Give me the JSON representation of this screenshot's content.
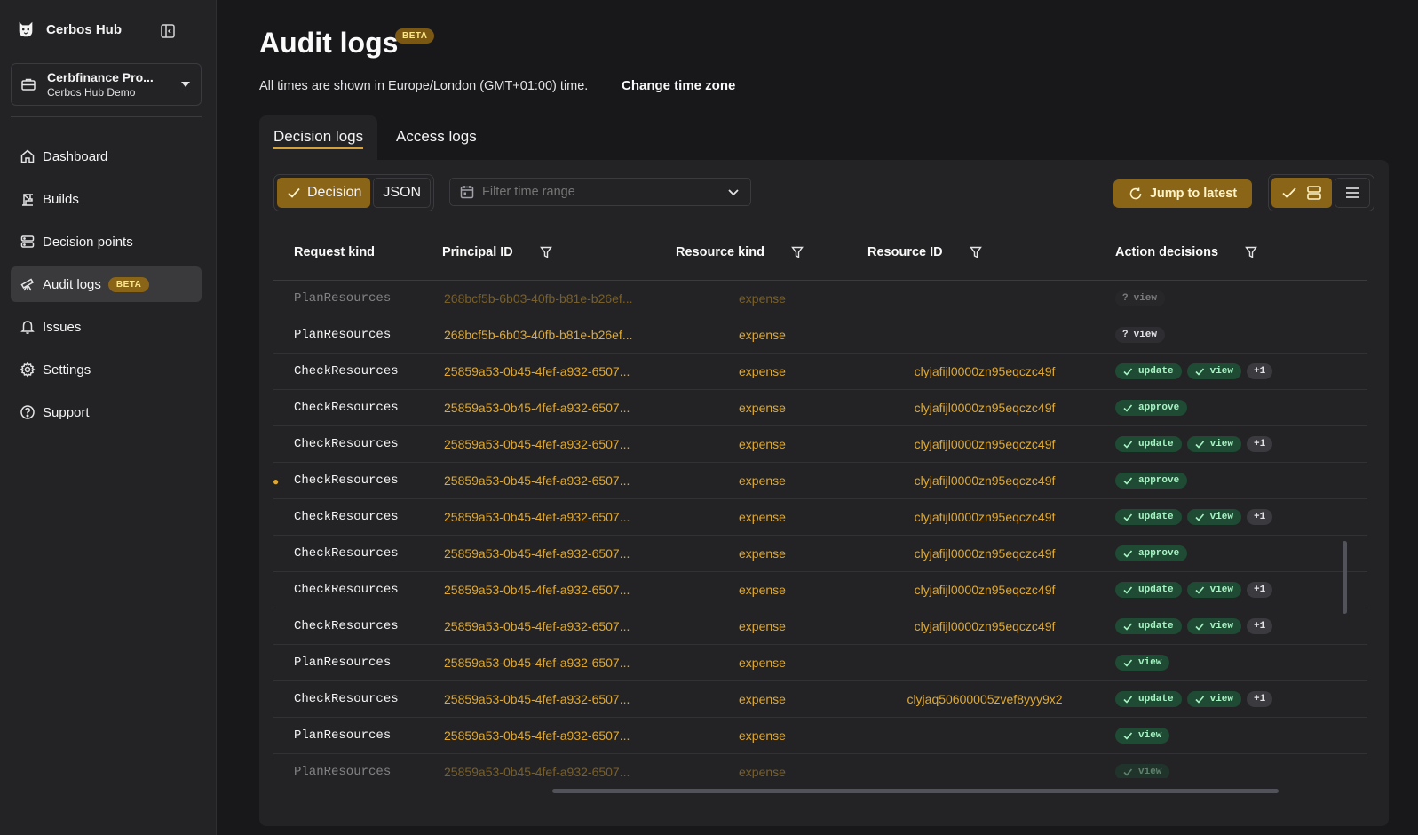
{
  "brand": {
    "name": "Cerbos Hub"
  },
  "org": {
    "name": "Cerbfinance Pro...",
    "subtitle": "Cerbos Hub Demo"
  },
  "nav": {
    "items": [
      {
        "label": "Dashboard",
        "icon": "home-icon"
      },
      {
        "label": "Builds",
        "icon": "crane-icon"
      },
      {
        "label": "Decision points",
        "icon": "server-icon"
      },
      {
        "label": "Audit logs",
        "icon": "telescope-icon",
        "badge": "BETA",
        "active": true
      },
      {
        "label": "Issues",
        "icon": "bell-icon"
      },
      {
        "label": "Settings",
        "icon": "gear-icon"
      },
      {
        "label": "Support",
        "icon": "help-circle-icon"
      }
    ]
  },
  "page": {
    "title": "Audit logs",
    "beta": "BETA",
    "tz_note": "All times are shown in Europe/London (GMT+01:00) time.",
    "tz_link": "Change time zone"
  },
  "tabs": {
    "decision": "Decision logs",
    "access": "Access logs"
  },
  "toolbar": {
    "seg_decision": "Decision",
    "seg_json": "JSON",
    "time_placeholder": "Filter time range",
    "jump": "Jump to latest"
  },
  "table": {
    "headers": {
      "kind": "Request kind",
      "principal": "Principal ID",
      "rkind": "Resource kind",
      "rid": "Resource ID",
      "actions": "Action decisions"
    },
    "rows": [
      {
        "kind": "PlanResources",
        "principal": "268bcf5b-6b03-40fb-b81e-b26ef...",
        "rkind": "expense",
        "rid": "",
        "actions": [
          {
            "label": "view",
            "type": "unknown"
          }
        ],
        "fade": true
      },
      {
        "kind": "PlanResources",
        "principal": "268bcf5b-6b03-40fb-b81e-b26ef...",
        "rkind": "expense",
        "rid": "",
        "actions": [
          {
            "label": "view",
            "type": "unknown"
          }
        ]
      },
      {
        "kind": "CheckResources",
        "principal": "25859a53-0b45-4fef-a932-6507...",
        "rkind": "expense",
        "rid": "clyjafijl0000zn95eqczc49f",
        "actions": [
          {
            "label": "update",
            "type": "allow"
          },
          {
            "label": "view",
            "type": "allow"
          },
          {
            "label": "+1",
            "type": "more"
          }
        ]
      },
      {
        "kind": "CheckResources",
        "principal": "25859a53-0b45-4fef-a932-6507...",
        "rkind": "expense",
        "rid": "clyjafijl0000zn95eqczc49f",
        "actions": [
          {
            "label": "approve",
            "type": "allow"
          }
        ]
      },
      {
        "kind": "CheckResources",
        "principal": "25859a53-0b45-4fef-a932-6507...",
        "rkind": "expense",
        "rid": "clyjafijl0000zn95eqczc49f",
        "actions": [
          {
            "label": "update",
            "type": "allow"
          },
          {
            "label": "view",
            "type": "allow"
          },
          {
            "label": "+1",
            "type": "more"
          }
        ]
      },
      {
        "kind": "CheckResources",
        "principal": "25859a53-0b45-4fef-a932-6507...",
        "rkind": "expense",
        "rid": "clyjafijl0000zn95eqczc49f",
        "actions": [
          {
            "label": "approve",
            "type": "allow"
          }
        ],
        "mark": true
      },
      {
        "kind": "CheckResources",
        "principal": "25859a53-0b45-4fef-a932-6507...",
        "rkind": "expense",
        "rid": "clyjafijl0000zn95eqczc49f",
        "actions": [
          {
            "label": "update",
            "type": "allow"
          },
          {
            "label": "view",
            "type": "allow"
          },
          {
            "label": "+1",
            "type": "more"
          }
        ]
      },
      {
        "kind": "CheckResources",
        "principal": "25859a53-0b45-4fef-a932-6507...",
        "rkind": "expense",
        "rid": "clyjafijl0000zn95eqczc49f",
        "actions": [
          {
            "label": "approve",
            "type": "allow"
          }
        ]
      },
      {
        "kind": "CheckResources",
        "principal": "25859a53-0b45-4fef-a932-6507...",
        "rkind": "expense",
        "rid": "clyjafijl0000zn95eqczc49f",
        "actions": [
          {
            "label": "update",
            "type": "allow"
          },
          {
            "label": "view",
            "type": "allow"
          },
          {
            "label": "+1",
            "type": "more"
          }
        ]
      },
      {
        "kind": "CheckResources",
        "principal": "25859a53-0b45-4fef-a932-6507...",
        "rkind": "expense",
        "rid": "clyjafijl0000zn95eqczc49f",
        "actions": [
          {
            "label": "update",
            "type": "allow"
          },
          {
            "label": "view",
            "type": "allow"
          },
          {
            "label": "+1",
            "type": "more"
          }
        ]
      },
      {
        "kind": "PlanResources",
        "principal": "25859a53-0b45-4fef-a932-6507...",
        "rkind": "expense",
        "rid": "",
        "actions": [
          {
            "label": "view",
            "type": "allow"
          }
        ]
      },
      {
        "kind": "CheckResources",
        "principal": "25859a53-0b45-4fef-a932-6507...",
        "rkind": "expense",
        "rid": "clyjaq50600005zvef8yyy9x2",
        "actions": [
          {
            "label": "update",
            "type": "allow"
          },
          {
            "label": "view",
            "type": "allow"
          },
          {
            "label": "+1",
            "type": "more"
          }
        ]
      },
      {
        "kind": "PlanResources",
        "principal": "25859a53-0b45-4fef-a932-6507...",
        "rkind": "expense",
        "rid": "",
        "actions": [
          {
            "label": "view",
            "type": "allow"
          }
        ]
      },
      {
        "kind": "PlanResources",
        "principal": "25859a53-0b45-4fef-a932-6507...",
        "rkind": "expense",
        "rid": "",
        "actions": [
          {
            "label": "view",
            "type": "allow"
          }
        ],
        "fade": true
      }
    ]
  },
  "colors": {
    "accent": "#8a6417",
    "link": "#e0a830",
    "allow_bg": "#1f4a33",
    "allow_fg": "#a7f3c4"
  }
}
